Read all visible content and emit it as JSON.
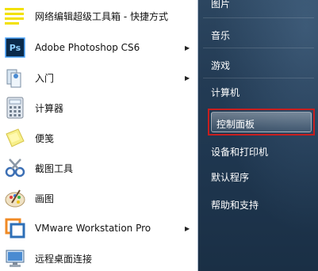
{
  "left_programs": [
    {
      "label": "网络编辑超级工具箱 - 快捷方式",
      "icon": "toolbox-shortcut-icon",
      "has_arrow": false
    },
    {
      "label": "Adobe Photoshop CS6",
      "icon": "photoshop-icon",
      "has_arrow": true
    },
    {
      "label": "入门",
      "icon": "getting-started-icon",
      "has_arrow": true
    },
    {
      "label": "计算器",
      "icon": "calculator-icon",
      "has_arrow": false
    },
    {
      "label": "便笺",
      "icon": "sticky-notes-icon",
      "has_arrow": false
    },
    {
      "label": "截图工具",
      "icon": "snipping-tool-icon",
      "has_arrow": false
    },
    {
      "label": "画图",
      "icon": "paint-icon",
      "has_arrow": false
    },
    {
      "label": "VMware Workstation Pro",
      "icon": "vmware-icon",
      "has_arrow": true
    },
    {
      "label": "远程桌面连接",
      "icon": "remote-desktop-icon",
      "has_arrow": false
    }
  ],
  "right_items": {
    "pictures": "图片",
    "music": "音乐",
    "games": "游戏",
    "computer": "计算机",
    "control_panel": "控制面板",
    "devices_printers": "设备和打印机",
    "default_programs": "默认程序",
    "help_support": "帮助和支持"
  },
  "colors": {
    "highlight_border": "#c81e1e",
    "right_pane": "#233b54"
  }
}
